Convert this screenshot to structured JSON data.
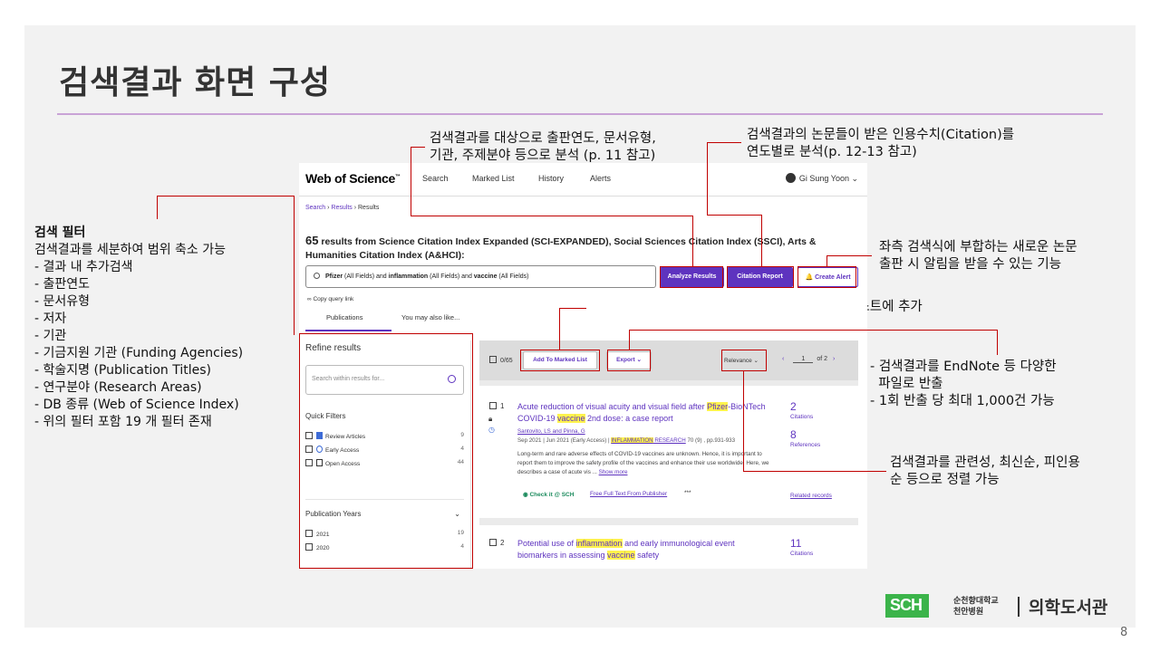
{
  "slide": {
    "title": "검색결과 화면 구성",
    "page_number": "8"
  },
  "annotations": {
    "analyze": "검색결과를 대상으로 출판연도, 문서유형,\n기관, 주제분야 등으로 분석 (p. 11 참고)",
    "citation": "검색결과의 논문들이 받은 인용수치(Citation)를\n연도별로 분석(p. 12-13 참고)",
    "alert": "좌측 검색식에 부합하는 새로운 논문\n출판 시 알림을 받을 수 있는 기능",
    "marked": "리스트의 좌측 체크박스로 선택한 논문을 개별 리스트에 추가",
    "export": "- 검색결과를 EndNote 등 다양한\n  파일로 반출\n- 1회 반출 당 최대 1,000건 가능",
    "sort": "검색결과를 관련성, 최신순, 피인용\n순 등으로 정렬 가능"
  },
  "left_panel": {
    "heading": "검색 필터",
    "lines": [
      "검색결과를 세분하여 범위 축소 가능",
      "- 결과 내 추가검색",
      "- 출판연도",
      "- 문서유형",
      "- 저자",
      "- 기관",
      "- 기금지원 기관 (Funding Agencies)",
      "- 학술지명 (Publication Titles)",
      "- 연구분야 (Research Areas)",
      "- DB 종류 (Web of Science Index)",
      "- 위의 필터 포함 19 개 필터 존재"
    ]
  },
  "screenshot": {
    "logo": "Web of Science",
    "logo_tm": "™",
    "nav": [
      "Search",
      "Marked List",
      "History",
      "Alerts"
    ],
    "user": "Gi Sung Yoon ⌄",
    "breadcrumb": {
      "a": "Search",
      "b": "Results",
      "c": "Results",
      "sep": " › "
    },
    "result_count": "65",
    "result_text": " results from Science Citation Index Expanded (SCI-EXPANDED), Social Sciences Citation Index (SSCI), Arts & Humanities Citation Index (A&HCI):",
    "query": {
      "t1": "Pfizer",
      "f1": " (All Fields) and ",
      "t2": "inflammation",
      "f2": " (All Fields) and ",
      "t3": "vaccine",
      "f3": " (All Fields)"
    },
    "analyze_btn": "Analyze Results",
    "citation_btn": "Citation Report",
    "alert_btn": "🔔 Create Alert",
    "copy_link": "∞ Copy query link",
    "tabs": [
      "Publications",
      "You may also like..."
    ],
    "refine": {
      "title": "Refine results",
      "search_placeholder": "Search within results for...",
      "quick_filters": "Quick Filters",
      "filters": [
        {
          "label": "Review Articles",
          "count": "9"
        },
        {
          "label": "Early Access",
          "count": "4"
        },
        {
          "label": "Open Access",
          "count": "44"
        }
      ],
      "pub_years": "Publication Years",
      "chevron": "⌄",
      "years": [
        {
          "label": "2021",
          "count": "19"
        },
        {
          "label": "2020",
          "count": "4"
        }
      ]
    },
    "toolbar": {
      "selected": "0/65",
      "marked_btn": "Add To Marked List",
      "export_btn": "Export ⌄",
      "sort": "Relevance ⌄",
      "page": "1",
      "of": "of 2",
      "prev": "‹",
      "next": "›"
    },
    "results": [
      {
        "num": "1",
        "title_a": "Acute reduction of visual acuity and visual field after ",
        "title_hl1": "Pfizer",
        "title_b": "-BioNTech COVID-19 ",
        "title_hl2": "vaccine",
        "title_c": " 2nd dose: a case report",
        "authors": "Santovito, LS and Pinna, G",
        "meta": "Sep 2021 | Jun 2021 (Early Access) | ",
        "journal_hl": "INFLAMMATION",
        "journal": " RESEARCH",
        "meta_tail": " 70 (9) , pp.931-933",
        "abstract": "Long-term and rare adverse effects of COVID-19 vaccines are unknown. Hence, it is important to report them to improve the safety profile of the vaccines and enhance their use worldwide. Here, we describes a case of acute vis ...",
        "show_more": "Show more",
        "check": "◉ Check it @ SCH",
        "full_text": "Free Full Text From Publisher",
        "dots": "***",
        "citations": "2",
        "citations_label": "Citations",
        "references": "8",
        "references_label": "References",
        "related": "Related records"
      },
      {
        "num": "2",
        "title_a": "Potential use of ",
        "title_hl1": "inflammation",
        "title_b": " and early immunological event biomarkers in assessing ",
        "title_hl2": "vaccine",
        "title_c": " safety",
        "citations": "11",
        "citations_label": "Citations"
      }
    ]
  },
  "footer_logo": {
    "sch": "SCH",
    "line1": "순천향대학교",
    "line2": "천안병원",
    "library": "의학도서관"
  },
  "colors": {
    "accent": "#5e33bf",
    "annotation_red": "#c00000",
    "highlight": "#fff34d",
    "rule": "#c9a3d6",
    "logo_green": "#3bb44a"
  }
}
